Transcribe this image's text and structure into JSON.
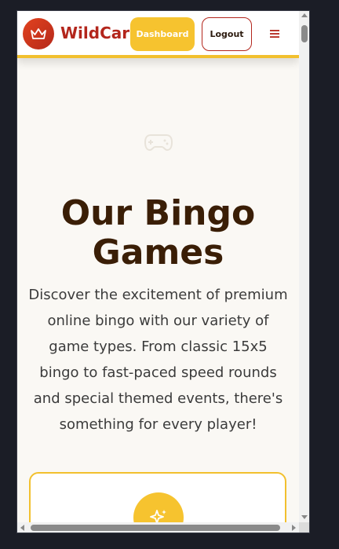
{
  "header": {
    "brand": "WildCard",
    "logo_icon": "crown-icon",
    "dashboard_label": "Dashboard",
    "logout_label": "Logout",
    "menu_icon": "hamburger-menu-icon"
  },
  "hero": {
    "icon": "gamepad-icon",
    "title": "Our Bingo Games",
    "description": "Discover the excitement of premium online bingo with our variety of game types. From classic 15x5 bingo to fast-paced speed rounds and special themed events, there's something for every player!"
  },
  "feature_card": {
    "icon": "sparkles-icon"
  },
  "colors": {
    "brand_red": "#b3261c",
    "accent_yellow": "#f6c32f",
    "title_brown": "#3a1e06",
    "page_bg": "#faf8f4"
  }
}
